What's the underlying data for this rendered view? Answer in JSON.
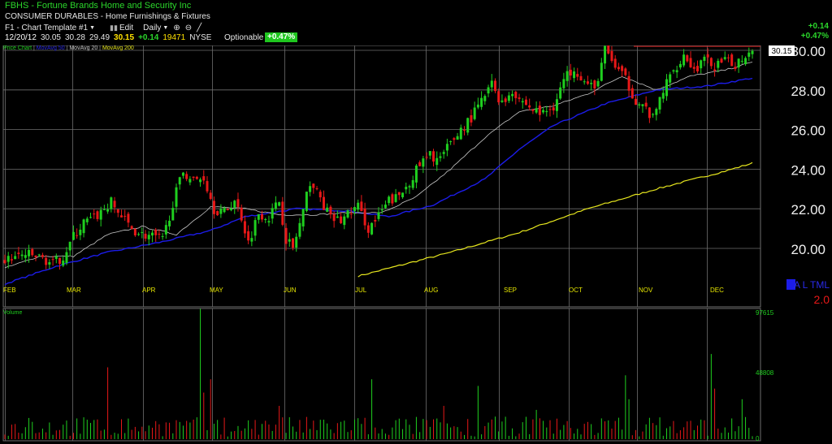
{
  "header": {
    "title": "FBHS - Fortune Brands Home and Security Inc",
    "industry": "CONSUMER DURABLES - Home Furnishings & Fixtures",
    "template_label": "F1 - Chart Template #1",
    "edit_label": "Edit",
    "interval_label": "Daily",
    "quote": {
      "date": "12/20/12",
      "open": "30.05",
      "high": "30.28",
      "low": "29.49",
      "last": "30.15",
      "change": "+0.14",
      "volume": "19471",
      "exchange": "NYSE"
    },
    "optionable_label": "Optionable",
    "pct_badge": "+0.47%",
    "right_change": "+0.14",
    "right_pct": "+0.47%"
  },
  "price_panel": {
    "legend": {
      "price_chart": "Price Chart",
      "sep1": " | ",
      "ma_50": "MovAvg 50",
      "sep2": " | ",
      "ma_20": "MovAvg 20",
      "sep3": " | ",
      "ma_200": "MovAvg 200"
    },
    "last_price_tag": "30.15",
    "watermark_icon": "a-letter-icon",
    "watermark_text": "A L TML",
    "version": "2.0"
  },
  "volume_panel": {
    "label": "Volume",
    "tick_labels": [
      "97615",
      "48808",
      "0"
    ]
  },
  "colors": {
    "up": "#1fcf1f",
    "down": "#e81818",
    "ma20": "#c8c8c8",
    "ma50": "#1c1ce8",
    "ma200": "#e6e61e",
    "grid": "#6e6e6e",
    "resistance": "#d01a1a"
  },
  "chart_data": {
    "type": "candlestick",
    "x_months": [
      "FEB",
      "MAR",
      "APR",
      "MAY",
      "JUN",
      "JUL",
      "AUG",
      "SEP",
      "OCT",
      "NOV",
      "DEC"
    ],
    "y_ticks": [
      "20.00",
      "22.00",
      "24.00",
      "26.00",
      "28.00",
      "30.00"
    ],
    "ylim": [
      18.2,
      30.3
    ],
    "resistance_level": 30.2,
    "close_anchors": [
      [
        0,
        19.4
      ],
      [
        6,
        19.7
      ],
      [
        11,
        19.5
      ],
      [
        14,
        19.2
      ],
      [
        17,
        19.6
      ],
      [
        20,
        20.6
      ],
      [
        23,
        21.3
      ],
      [
        26,
        21.5
      ],
      [
        29,
        22.0
      ],
      [
        31,
        22.3
      ],
      [
        34,
        21.6
      ],
      [
        37,
        21.0
      ],
      [
        40,
        20.7
      ],
      [
        43,
        20.6
      ],
      [
        46,
        20.4
      ],
      [
        49,
        22.3
      ],
      [
        52,
        23.9
      ],
      [
        55,
        23.4
      ],
      [
        58,
        23.6
      ],
      [
        61,
        22.0
      ],
      [
        64,
        21.8
      ],
      [
        67,
        22.4
      ],
      [
        69,
        21.6
      ],
      [
        71,
        20.3
      ],
      [
        74,
        21.8
      ],
      [
        77,
        21.6
      ],
      [
        80,
        22.4
      ],
      [
        82,
        20.5
      ],
      [
        84,
        20.0
      ],
      [
        87,
        21.8
      ],
      [
        89,
        23.4
      ],
      [
        92,
        22.5
      ],
      [
        95,
        21.5
      ],
      [
        98,
        21.4
      ],
      [
        101,
        21.9
      ],
      [
        103,
        22.1
      ],
      [
        106,
        21.0
      ],
      [
        109,
        21.6
      ],
      [
        112,
        22.4
      ],
      [
        115,
        22.6
      ],
      [
        118,
        23.4
      ],
      [
        121,
        24.2
      ],
      [
        124,
        24.7
      ],
      [
        127,
        24.5
      ],
      [
        130,
        25.3
      ],
      [
        133,
        26.0
      ],
      [
        136,
        26.6
      ],
      [
        139,
        27.4
      ],
      [
        142,
        28.3
      ],
      [
        145,
        27.3
      ],
      [
        148,
        28.0
      ],
      [
        151,
        27.4
      ],
      [
        154,
        27.0
      ],
      [
        157,
        26.8
      ],
      [
        160,
        27.2
      ],
      [
        163,
        28.5
      ],
      [
        166,
        29.2
      ],
      [
        169,
        28.4
      ],
      [
        172,
        28.0
      ],
      [
        175,
        30.0
      ],
      [
        178,
        29.2
      ],
      [
        181,
        28.5
      ],
      [
        184,
        27.5
      ],
      [
        187,
        27.0
      ],
      [
        189,
        26.5
      ],
      [
        192,
        28.0
      ],
      [
        195,
        29.0
      ],
      [
        198,
        29.8
      ],
      [
        201,
        29.0
      ],
      [
        204,
        29.5
      ],
      [
        207,
        29.2
      ],
      [
        210,
        29.4
      ],
      [
        213,
        29.3
      ],
      [
        216,
        29.8
      ],
      [
        218,
        30.1
      ]
    ],
    "ma20_anchors": [
      [
        0,
        19.0
      ],
      [
        10,
        19.6
      ],
      [
        20,
        19.6
      ],
      [
        30,
        20.7
      ],
      [
        40,
        21.1
      ],
      [
        50,
        20.7
      ],
      [
        60,
        22.1
      ],
      [
        70,
        22.0
      ],
      [
        80,
        21.7
      ],
      [
        90,
        21.7
      ],
      [
        100,
        21.8
      ],
      [
        110,
        21.8
      ],
      [
        120,
        22.6
      ],
      [
        130,
        24.0
      ],
      [
        140,
        25.6
      ],
      [
        150,
        26.9
      ],
      [
        160,
        27.2
      ],
      [
        170,
        27.8
      ],
      [
        180,
        28.7
      ],
      [
        190,
        28.0
      ],
      [
        200,
        28.7
      ],
      [
        210,
        29.0
      ],
      [
        218,
        29.4
      ]
    ],
    "ma50_anchors": [
      [
        0,
        18.2
      ],
      [
        15,
        19.1
      ],
      [
        30,
        19.8
      ],
      [
        45,
        20.3
      ],
      [
        60,
        20.9
      ],
      [
        70,
        21.6
      ],
      [
        85,
        22.0
      ],
      [
        100,
        21.9
      ],
      [
        112,
        21.6
      ],
      [
        125,
        22.2
      ],
      [
        140,
        23.5
      ],
      [
        150,
        25.0
      ],
      [
        160,
        26.2
      ],
      [
        175,
        27.3
      ],
      [
        190,
        28.0
      ],
      [
        205,
        28.2
      ],
      [
        218,
        28.6
      ]
    ],
    "ma200_anchors": [
      [
        103,
        18.6
      ],
      [
        130,
        19.8
      ],
      [
        150,
        20.8
      ],
      [
        170,
        22.0
      ],
      [
        190,
        23.0
      ],
      [
        210,
        23.9
      ],
      [
        218,
        24.3
      ]
    ],
    "ma200_start_bar": 103,
    "bar_count": 219,
    "volume": {
      "ymax": 97615,
      "spikes": [
        [
          6,
          9000
        ],
        [
          8,
          13000
        ],
        [
          30,
          54000
        ],
        [
          57,
          98000
        ],
        [
          58,
          35000
        ],
        [
          60,
          45000
        ],
        [
          80,
          25000
        ],
        [
          107,
          45000
        ],
        [
          128,
          25000
        ],
        [
          138,
          40000
        ],
        [
          155,
          22000
        ],
        [
          181,
          48000
        ],
        [
          182,
          30000
        ],
        [
          206,
          64000
        ],
        [
          207,
          38000
        ],
        [
          215,
          30000
        ]
      ],
      "base_range": [
        2000,
        17000
      ]
    }
  }
}
